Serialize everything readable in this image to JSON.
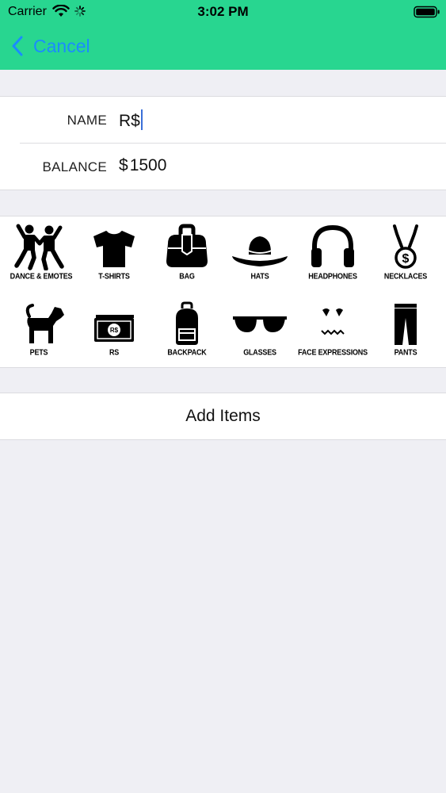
{
  "status_bar": {
    "carrier": "Carrier",
    "time": "3:02 PM"
  },
  "nav": {
    "back_label": "Cancel"
  },
  "form": {
    "name_label": "NAME",
    "name_value": "R$",
    "balance_label": "BALANCE",
    "balance_currency": "$",
    "balance_value": "1500"
  },
  "categories": [
    {
      "label": "DANCE & EMOTES",
      "icon": "dance-icon"
    },
    {
      "label": "T-SHIRTS",
      "icon": "tshirt-icon"
    },
    {
      "label": "BAG",
      "icon": "bag-icon"
    },
    {
      "label": "HATS",
      "icon": "hat-icon"
    },
    {
      "label": "HEADPHONES",
      "icon": "headphones-icon"
    },
    {
      "label": "NECKLACES",
      "icon": "necklace-icon"
    },
    {
      "label": "PETS",
      "icon": "pet-icon"
    },
    {
      "label": "RS",
      "icon": "money-icon"
    },
    {
      "label": "BACKPACK",
      "icon": "backpack-icon"
    },
    {
      "label": "GLASSES",
      "icon": "glasses-icon"
    },
    {
      "label": "FACE EXPRESSIONS",
      "icon": "face-icon"
    },
    {
      "label": "PANTS",
      "icon": "pants-icon"
    }
  ],
  "actions": {
    "add_items_label": "Add Items"
  },
  "colors": {
    "nav_background": "#28d690",
    "link_blue": "#1a8cff",
    "page_background": "#efeff4"
  }
}
